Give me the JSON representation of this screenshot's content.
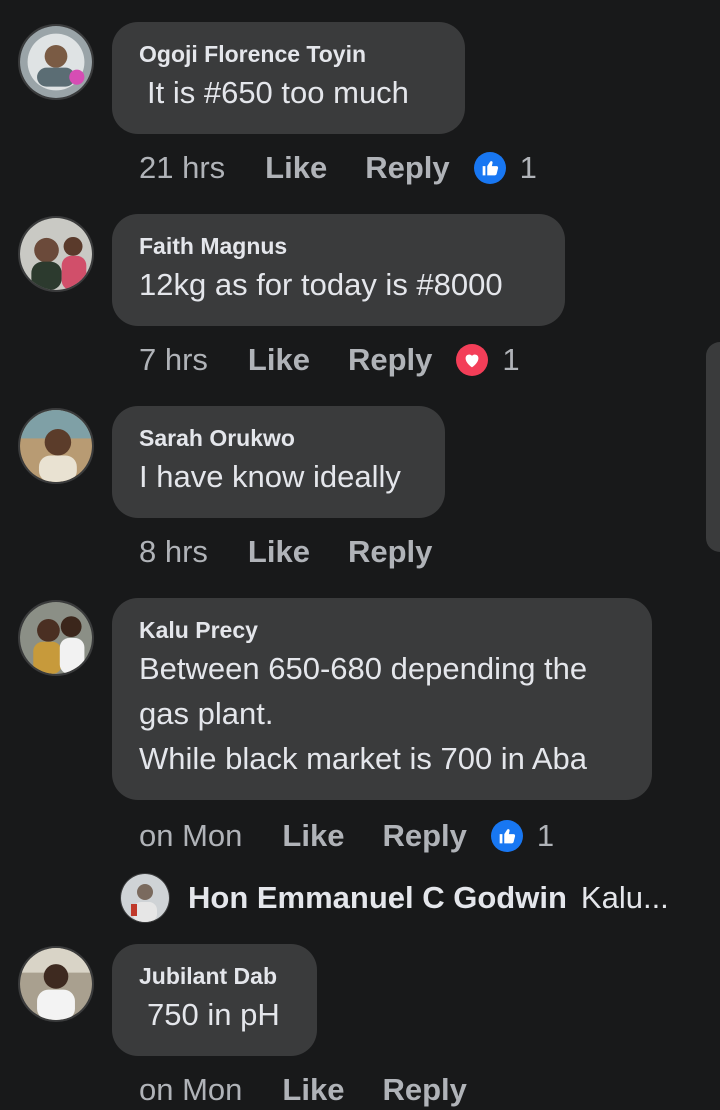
{
  "comments": [
    {
      "author": "Ogoji Florence Toyin",
      "text": "It is #650 too much",
      "time": "21 hrs",
      "like": "Like",
      "reply": "Reply",
      "reaction": "like",
      "reaction_count": "1"
    },
    {
      "author": "Faith Magnus",
      "text": "12kg as for today is #8000",
      "time": "7 hrs",
      "like": "Like",
      "reply": "Reply",
      "reaction": "love",
      "reaction_count": "1"
    },
    {
      "author": "Sarah Orukwo",
      "text": "I have know ideally",
      "time": "8 hrs",
      "like": "Like",
      "reply": "Reply"
    },
    {
      "author": "Kalu Precy",
      "text_lines": [
        "Between 650-680 depending the",
        "gas plant.",
        "While black market is 700 in Aba"
      ],
      "time": "on Mon",
      "like": "Like",
      "reply": "Reply",
      "reaction": "like",
      "reaction_count": "1"
    },
    {
      "author": "Jubilant Dab",
      "text": "750 in pH",
      "time": "on Mon",
      "like": "Like",
      "reply": "Reply"
    }
  ],
  "reply_preview": {
    "author": "Hon Emmanuel C Godwin",
    "text": "Kalu..."
  },
  "colors": {
    "background": "#18191a",
    "bubble": "#3a3b3c",
    "like_blue": "#1877f2",
    "love_red": "#f33e58"
  }
}
